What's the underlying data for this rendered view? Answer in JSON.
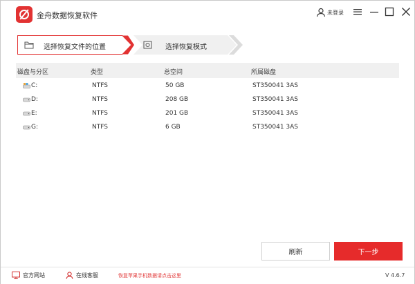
{
  "app": {
    "title": "金舟数据恢复软件",
    "login_label": "未登录",
    "accent": "#e23232"
  },
  "steps": [
    {
      "label": "选择恢复文件的位置",
      "active": true
    },
    {
      "label": "选择恢复模式",
      "active": false
    }
  ],
  "table": {
    "headers": {
      "disk": "磁盘与分区",
      "type": "类型",
      "total": "总空间",
      "belongs": "所属磁盘"
    },
    "rows": [
      {
        "name": "C:",
        "type": "NTFS",
        "size": "50 GB",
        "disk": "ST350041 3AS",
        "icon": "system-drive-icon"
      },
      {
        "name": "D:",
        "type": "NTFS",
        "size": "208 GB",
        "disk": "ST350041 3AS",
        "icon": "hard-drive-icon"
      },
      {
        "name": "E:",
        "type": "NTFS",
        "size": "201 GB",
        "disk": "ST350041 3AS",
        "icon": "hard-drive-icon"
      },
      {
        "name": "G:",
        "type": "NTFS",
        "size": "6 GB",
        "disk": "ST350041 3AS",
        "icon": "hard-drive-icon"
      }
    ]
  },
  "buttons": {
    "refresh": "刷新",
    "next": "下一步"
  },
  "footer": {
    "website": "官方网站",
    "support": "在线客服",
    "promo": "恢复苹果手机数据请点击这里",
    "version": "V 4.6.7"
  }
}
